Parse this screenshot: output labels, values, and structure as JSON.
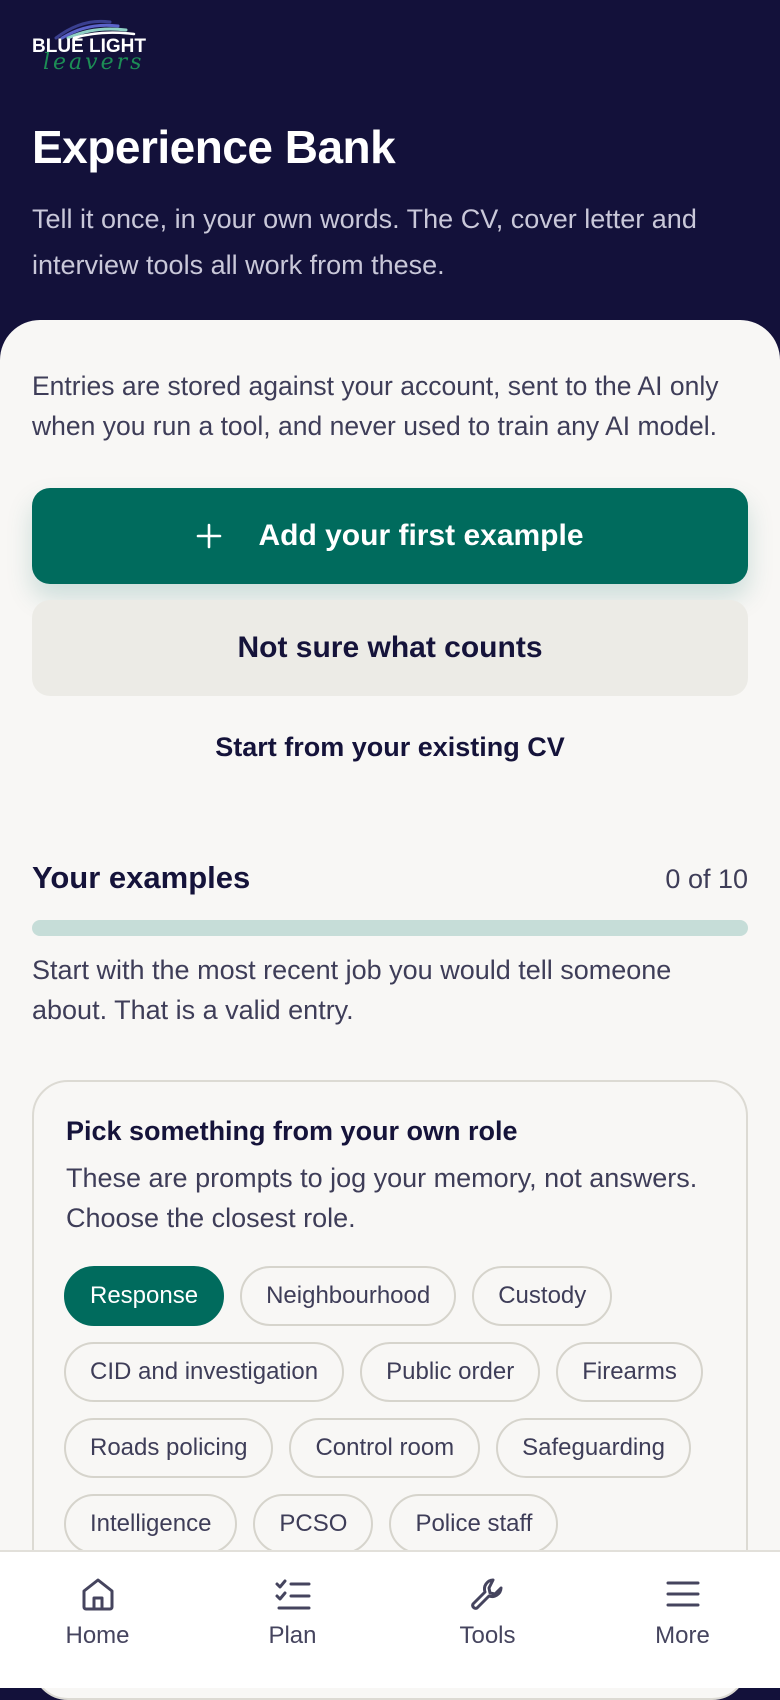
{
  "brand": {
    "name_top": "BLUE LIGHT",
    "name_bottom": "leavers"
  },
  "header": {
    "title": "Experience Bank",
    "subtitle": "Tell it once, in your own words. The CV, cover letter and interview tools all work from these."
  },
  "privacy_note": "Entries are stored against your account, sent to the AI only when you run a tool, and never used to train any AI model.",
  "actions": {
    "primary_label": "Add your first example",
    "primary_icon": "plus-icon",
    "secondary_label": "Not sure what counts",
    "link_label": "Start from your existing CV"
  },
  "examples": {
    "title": "Your examples",
    "count_label": "0 of 10",
    "progress_fraction": 0.0,
    "hint": "Start with the most recent job you would tell someone about. That is a valid entry."
  },
  "role_picker": {
    "title": "Pick something from your own role",
    "description": "These are prompts to jog your memory, not answers. Choose the closest role.",
    "selected": "Response",
    "roles": [
      "Response",
      "Neighbourhood",
      "Custody",
      "CID and investigation",
      "Public order",
      "Firearms",
      "Roads policing",
      "Control room",
      "Safeguarding",
      "Intelligence",
      "PCSO",
      "Police staff"
    ]
  },
  "nav": {
    "items": [
      {
        "label": "Home",
        "icon": "home-icon"
      },
      {
        "label": "Plan",
        "icon": "checklist-icon"
      },
      {
        "label": "Tools",
        "icon": "wrench-icon"
      },
      {
        "label": "More",
        "icon": "menu-icon"
      }
    ]
  },
  "colors": {
    "header_bg": "#13113a",
    "accent": "#006b5d",
    "sheet_bg": "#f8f7f5",
    "brand_green": "#1c8d55"
  }
}
